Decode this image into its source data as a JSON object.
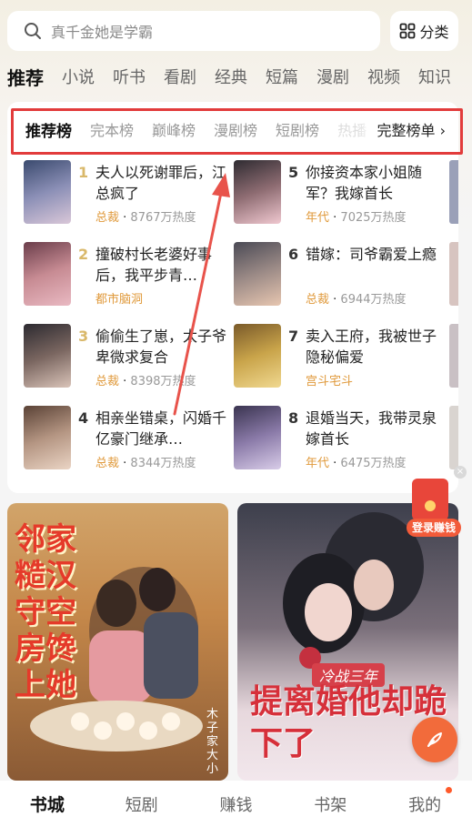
{
  "search": {
    "placeholder": "真千金她是学霸"
  },
  "category_button": {
    "label": "分类",
    "icon": "grid-icon"
  },
  "top_tabs": [
    "推荐",
    "小说",
    "听书",
    "看剧",
    "经典",
    "短篇",
    "漫剧",
    "视频",
    "知识"
  ],
  "rank_tabs": [
    "推荐榜",
    "完本榜",
    "巅峰榜",
    "漫剧榜",
    "短剧榜",
    "热播"
  ],
  "rank_more": "完整榜单 ›",
  "rank_items": [
    {
      "rank": "1",
      "title": "夫人以死谢罪后，江总疯了",
      "tag": "总裁",
      "heat": "8767万热度"
    },
    {
      "rank": "2",
      "title": "撞破村长老婆好事后，我平步青…",
      "tag": "都市脑洞",
      "heat": ""
    },
    {
      "rank": "3",
      "title": "偷偷生了崽，太子爷卑微求复合",
      "tag": "总裁",
      "heat": "8398万热度"
    },
    {
      "rank": "4",
      "title": "相亲坐错桌，闪婚千亿豪门继承…",
      "tag": "总裁",
      "heat": "8344万热度"
    },
    {
      "rank": "5",
      "title": "你接资本家小姐随军？我嫁首长",
      "tag": "年代",
      "heat": "7025万热度"
    },
    {
      "rank": "6",
      "title": "错嫁：司爷霸爱上瘾",
      "tag": "总裁",
      "heat": "6944万热度"
    },
    {
      "rank": "7",
      "title": "卖入王府，我被世子隐秘偏爱",
      "tag": "宫斗宅斗",
      "heat": ""
    },
    {
      "rank": "8",
      "title": "退婚当天，我带灵泉嫁首长",
      "tag": "年代",
      "heat": "6475万热度"
    }
  ],
  "banners": [
    {
      "title": "邻家糙汉守空房馋上她",
      "author": "木子家大小"
    },
    {
      "subtitle": "冷战三年",
      "title": "提离婚他却跪下了"
    }
  ],
  "float_red_packet": {
    "label": "登录赚钱"
  },
  "bottom_nav": [
    "书城",
    "短剧",
    "赚钱",
    "书架",
    "我的"
  ],
  "colors": {
    "accent_gold": "#d9b86a",
    "tag_orange": "#e09a3c",
    "highlight_red": "#e23b3b",
    "fab_orange": "#f26b3b"
  }
}
